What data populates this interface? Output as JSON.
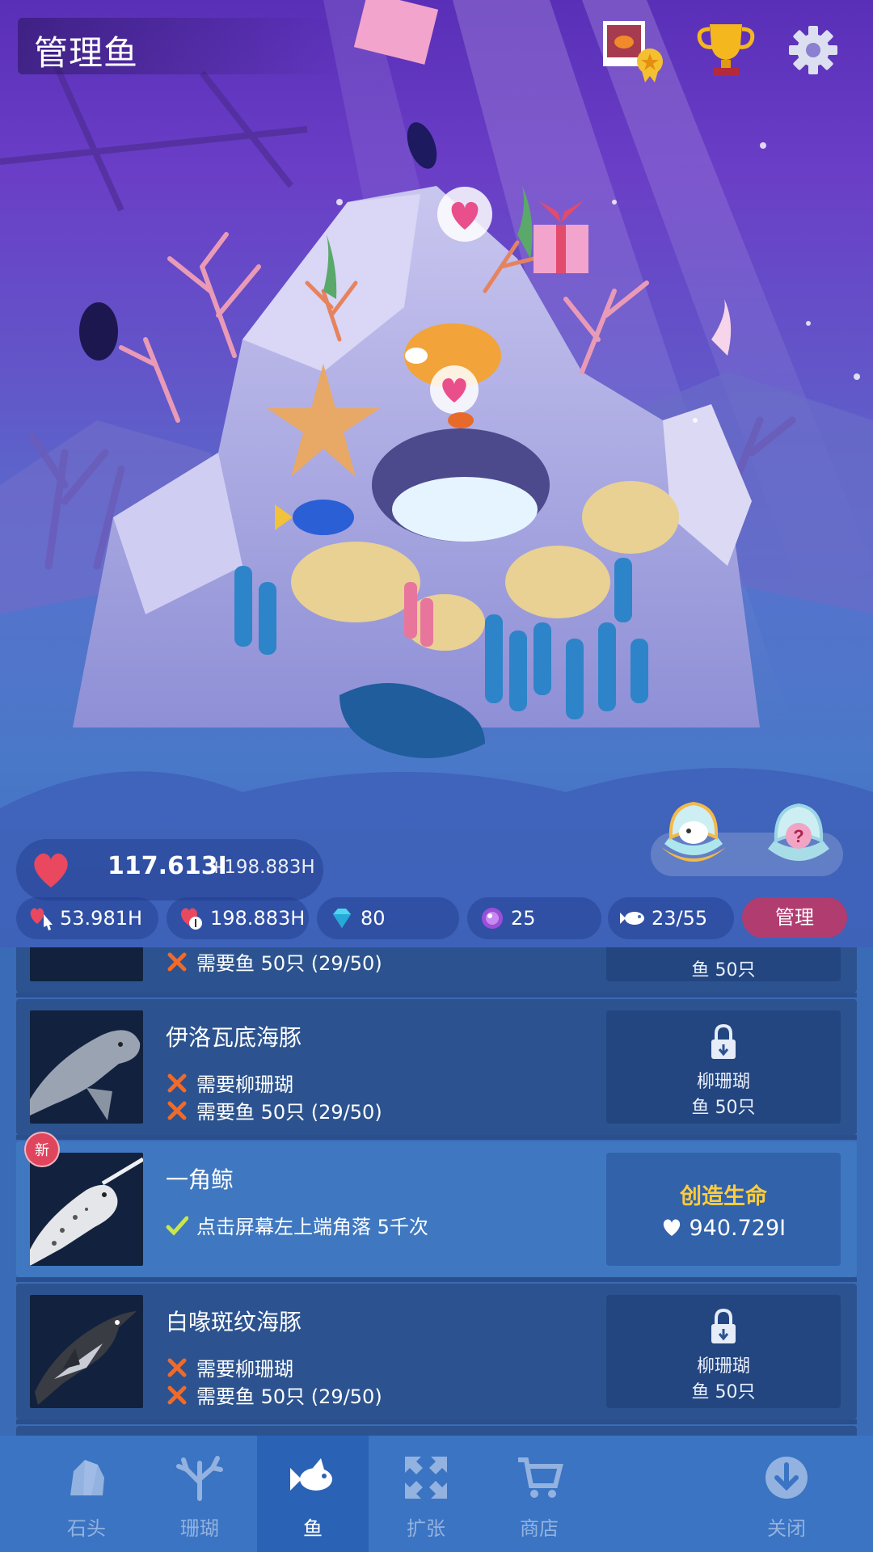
{
  "header": {
    "title": "管理鱼",
    "icons": [
      "photo-award-icon",
      "trophy-icon",
      "gear-icon"
    ]
  },
  "stats": {
    "heart_total": "117.613I",
    "heart_rate": "+198.883H",
    "chips": [
      {
        "icon": "tap-heart-icon",
        "value": "53.981H"
      },
      {
        "icon": "coin-heart-icon",
        "value": "198.883H"
      },
      {
        "icon": "diamond-icon",
        "value": "80"
      },
      {
        "icon": "pearl-icon",
        "value": "25"
      },
      {
        "icon": "fish-icon",
        "value": "23/55"
      }
    ],
    "manage_label": "管理"
  },
  "list": {
    "partial_top": {
      "req": "需要鱼 50只 (29/50)",
      "right": "鱼 50只"
    },
    "rows": [
      {
        "name": "伊洛瓦底海豚",
        "state": "locked",
        "reqs": [
          {
            "met": false,
            "text": "需要柳珊瑚"
          },
          {
            "met": false,
            "text": "需要鱼 50只 (29/50)"
          }
        ],
        "lock_line1": "柳珊瑚",
        "lock_line2": "鱼 50只"
      },
      {
        "name": "一角鲸",
        "state": "available",
        "badge": "新",
        "reqs": [
          {
            "met": true,
            "text": "点击屏幕左上端角落 5千次"
          }
        ],
        "create_label": "创造生命",
        "create_cost": "940.729I"
      },
      {
        "name": "白喙斑纹海豚",
        "state": "locked",
        "reqs": [
          {
            "met": false,
            "text": "需要柳珊瑚"
          },
          {
            "met": false,
            "text": "需要鱼 50只 (29/50)"
          }
        ],
        "lock_line1": "柳珊瑚",
        "lock_line2": "鱼 50只"
      }
    ]
  },
  "nav": [
    {
      "label": "石头",
      "icon": "rock-icon",
      "active": false
    },
    {
      "label": "珊瑚",
      "icon": "coral-icon",
      "active": false
    },
    {
      "label": "鱼",
      "icon": "fish-icon",
      "active": true
    },
    {
      "label": "扩张",
      "icon": "expand-icon",
      "active": false
    },
    {
      "label": "商店",
      "icon": "cart-icon",
      "active": false
    },
    {
      "label": "关闭",
      "icon": "close-down-icon",
      "active": false
    }
  ],
  "colors": {
    "accent_yellow": "#ffcc3c",
    "manage_button": "#b03c70",
    "badge_red": "#e0455e",
    "heart_red": "#e9485e"
  }
}
